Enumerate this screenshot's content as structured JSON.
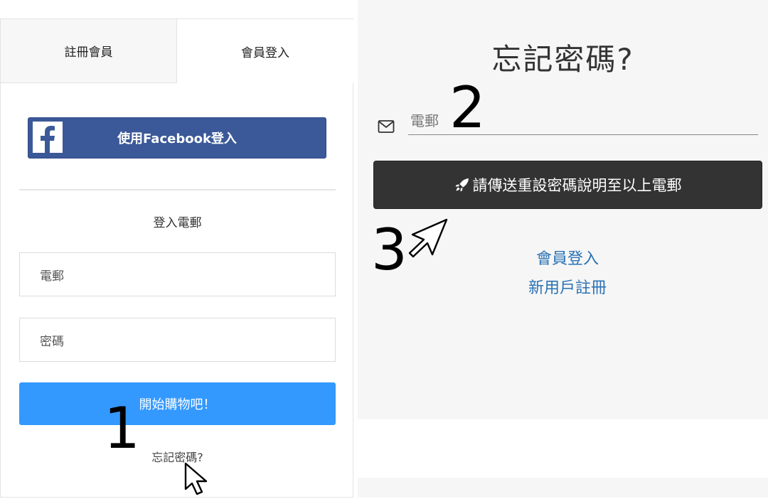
{
  "left": {
    "tabs": [
      {
        "label": "註冊會員"
      },
      {
        "label": "會員登入"
      }
    ],
    "facebook_button": "使用Facebook登入",
    "login_email_title": "登入電郵",
    "email_placeholder": "電郵",
    "password_placeholder": "密碼",
    "shop_button": "開始購物吧！",
    "forgot_link": "忘記密碼?"
  },
  "right": {
    "title": "忘記密碼?",
    "email_placeholder": "電郵",
    "send_button": "請傳送重設密碼說明至以上電郵",
    "member_login_link": "會員登入",
    "new_user_link": "新用戶註冊"
  },
  "steps": [
    "1",
    "2",
    "3"
  ],
  "icons": {
    "facebook": "facebook-logo-icon",
    "mail": "envelope-icon",
    "rocket": "rocket-icon",
    "cursor": "mouse-cursor-icon"
  },
  "colors": {
    "facebook": "#3b5998",
    "primary_button": "#3399ff",
    "dark_button": "#333333",
    "link": "#2a72b5",
    "right_background": "#f6f6f6"
  }
}
